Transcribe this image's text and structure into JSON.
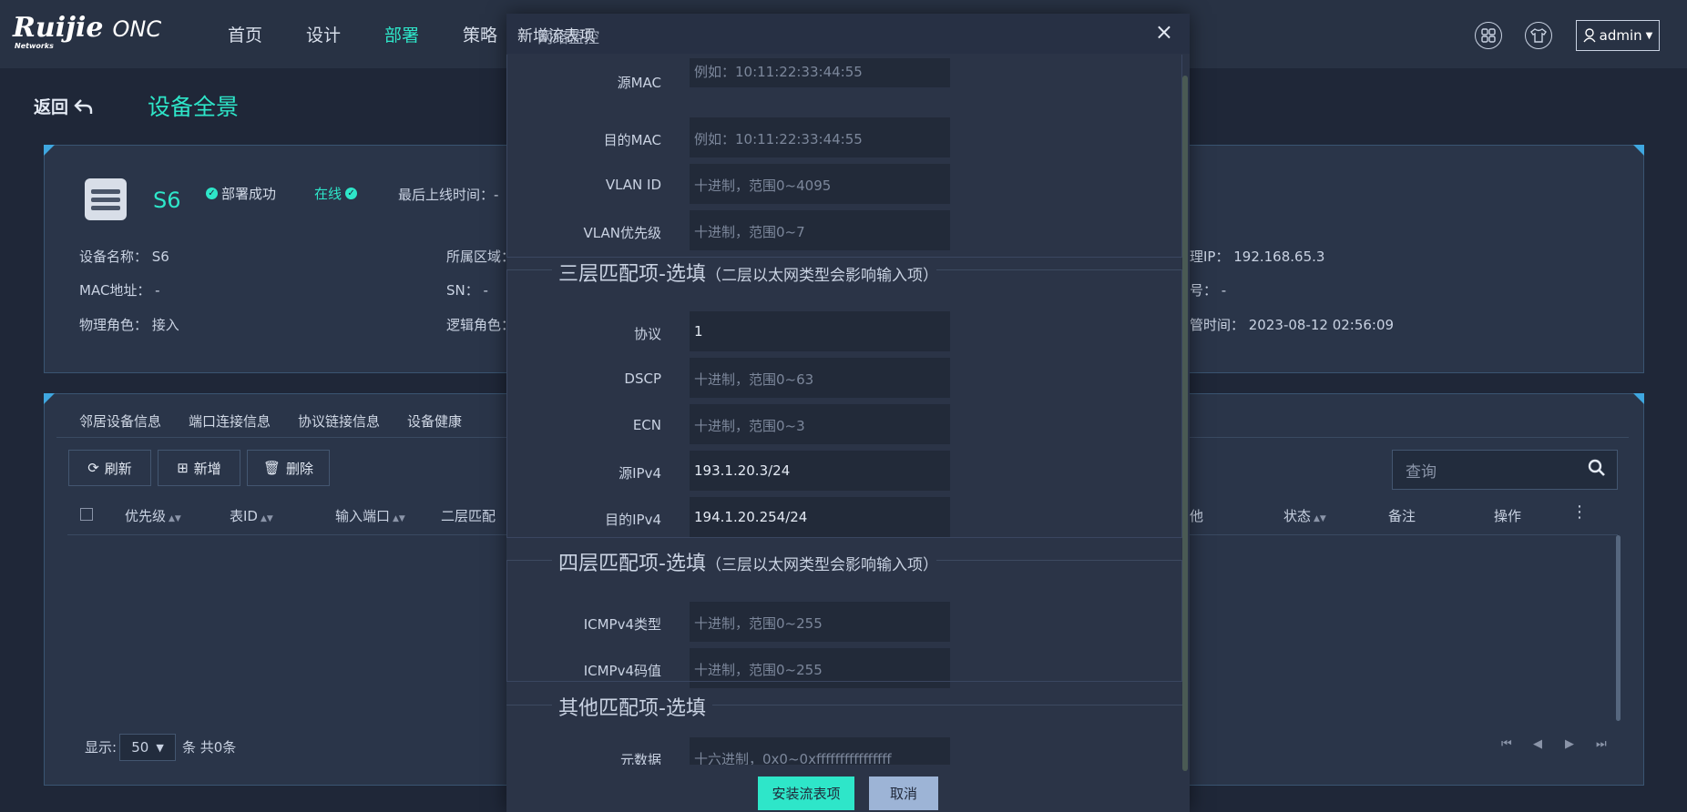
{
  "brand": {
    "logo": "Ruijie",
    "logo_sub": "Networks",
    "product": "ONC"
  },
  "nav": [
    "首页",
    "设计",
    "部署",
    "策略"
  ],
  "nav_active": "部署",
  "user": {
    "name": "admin"
  },
  "page": {
    "back_label": "返回",
    "title": "设备全景"
  },
  "device": {
    "name": "S6",
    "deploy_status": "部署成功",
    "online_status": "在线",
    "last_online_label": "最后上线时间：-",
    "fields": {
      "device_name": "设备名称：  S6",
      "area": "所属区域：",
      "mgmt_ip": "理IP：  192.168.65.3",
      "mac": "MAC地址：  -",
      "sn": "SN：  -",
      "model": "号：  -",
      "role": "物理角色：  接入",
      "logic_role": "逻辑角色：",
      "managed_time": "管时间：  2023-08-12 02:56:09"
    }
  },
  "tabs": [
    "邻居设备信息",
    "端口连接信息",
    "协议链接信息",
    "设备健康"
  ],
  "toolbar": {
    "refresh": "刷新",
    "add": "新增",
    "delete": "删除",
    "search_placeholder": "查询"
  },
  "table": {
    "columns": [
      "优先级",
      "表ID",
      "输入端口",
      "二层匹配",
      "他",
      "状态",
      "备注",
      "操作"
    ],
    "rows": []
  },
  "pagination": {
    "show_label": "显示:",
    "page_size": "50",
    "total_label": "条 共0条"
  },
  "modal": {
    "title": "新增流表项",
    "title_overlay": "网络监控",
    "close": "×",
    "l2_rows": [
      {
        "label": "源MAC",
        "placeholder": "例如：10:11:22:33:44:55",
        "value": ""
      },
      {
        "label": "目的MAC",
        "placeholder": "例如：10:11:22:33:44:55",
        "value": ""
      },
      {
        "label": "VLAN ID",
        "placeholder": "十进制，范围0~4095",
        "value": ""
      },
      {
        "label": "VLAN优先级",
        "placeholder": "十进制，范围0~7",
        "value": ""
      }
    ],
    "l3_title": "三层匹配项-选填",
    "l3_sub": "（二层以太网类型会影响输入项）",
    "l3_rows": [
      {
        "label": "协议",
        "placeholder": "",
        "value": "1"
      },
      {
        "label": "DSCP",
        "placeholder": "十进制，范围0~63",
        "value": ""
      },
      {
        "label": "ECN",
        "placeholder": "十进制，范围0~3",
        "value": ""
      },
      {
        "label": "源IPv4",
        "placeholder": "",
        "value": "193.1.20.3/24"
      },
      {
        "label": "目的IPv4",
        "placeholder": "",
        "value": "194.1.20.254/24"
      }
    ],
    "l4_title": "四层匹配项-选填",
    "l4_sub": "（三层以太网类型会影响输入项）",
    "l4_rows": [
      {
        "label": "ICMPv4类型",
        "placeholder": "十进制，范围0~255",
        "value": ""
      },
      {
        "label": "ICMPv4码值",
        "placeholder": "十进制，范围0~255",
        "value": ""
      }
    ],
    "other_title": "其他匹配项-选填",
    "other_rows": [
      {
        "label": "元数据",
        "placeholder": "十六进制，0x0~0xffffffffffffffff",
        "value": ""
      }
    ],
    "ok_label": "安装流表项",
    "cancel_label": "取消"
  },
  "colors": {
    "accent": "#2ee6c9",
    "bg": "#1f2738",
    "panel": "#2a3549",
    "modal": "#2b3447"
  }
}
